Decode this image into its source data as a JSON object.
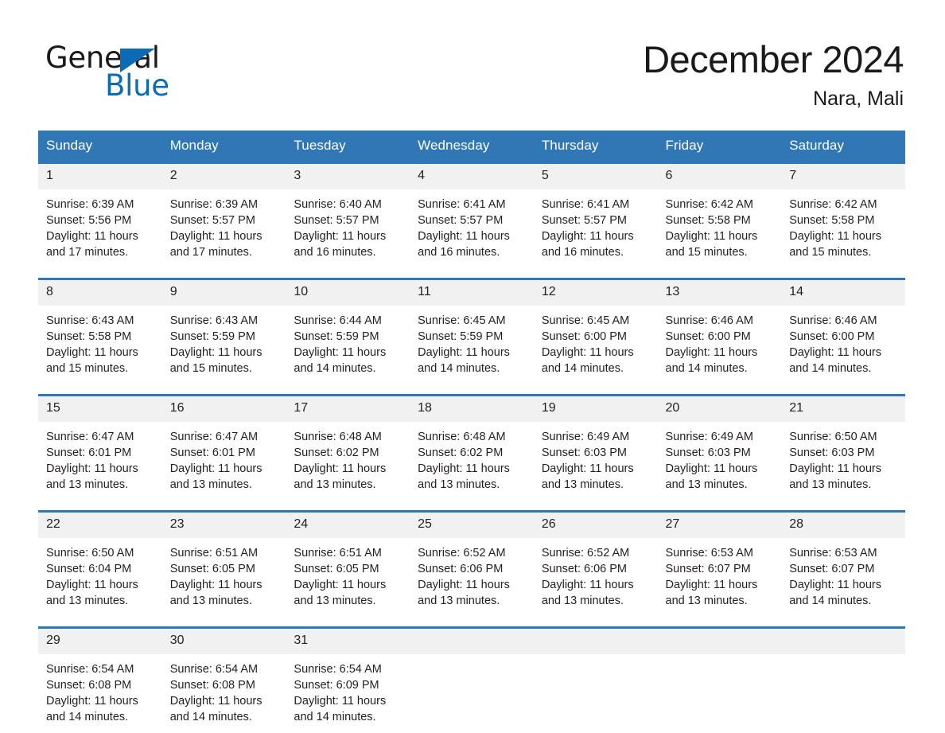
{
  "brand": {
    "name_top": "General",
    "name_bottom": "Blue",
    "triangle_color": "#0b6cb5",
    "logo_icon": "general-blue-logo"
  },
  "header": {
    "month_title": "December 2024",
    "location": "Nara, Mali"
  },
  "theme": {
    "header_blue": "#3077b5",
    "daynum_band": "#f1f1f1",
    "text": "#231f20",
    "page_background": "#ffffff"
  },
  "calendar": {
    "weekday_headers": [
      "Sunday",
      "Monday",
      "Tuesday",
      "Wednesday",
      "Thursday",
      "Friday",
      "Saturday"
    ],
    "labels": {
      "sunrise_prefix": "Sunrise:",
      "sunset_prefix": "Sunset:",
      "daylight_prefix": "Daylight:"
    },
    "weeks": [
      [
        {
          "day": "1",
          "sunrise": "Sunrise: 6:39 AM",
          "sunset": "Sunset: 5:56 PM",
          "daylight": "Daylight: 11 hours and 17 minutes."
        },
        {
          "day": "2",
          "sunrise": "Sunrise: 6:39 AM",
          "sunset": "Sunset: 5:57 PM",
          "daylight": "Daylight: 11 hours and 17 minutes."
        },
        {
          "day": "3",
          "sunrise": "Sunrise: 6:40 AM",
          "sunset": "Sunset: 5:57 PM",
          "daylight": "Daylight: 11 hours and 16 minutes."
        },
        {
          "day": "4",
          "sunrise": "Sunrise: 6:41 AM",
          "sunset": "Sunset: 5:57 PM",
          "daylight": "Daylight: 11 hours and 16 minutes."
        },
        {
          "day": "5",
          "sunrise": "Sunrise: 6:41 AM",
          "sunset": "Sunset: 5:57 PM",
          "daylight": "Daylight: 11 hours and 16 minutes."
        },
        {
          "day": "6",
          "sunrise": "Sunrise: 6:42 AM",
          "sunset": "Sunset: 5:58 PM",
          "daylight": "Daylight: 11 hours and 15 minutes."
        },
        {
          "day": "7",
          "sunrise": "Sunrise: 6:42 AM",
          "sunset": "Sunset: 5:58 PM",
          "daylight": "Daylight: 11 hours and 15 minutes."
        }
      ],
      [
        {
          "day": "8",
          "sunrise": "Sunrise: 6:43 AM",
          "sunset": "Sunset: 5:58 PM",
          "daylight": "Daylight: 11 hours and 15 minutes."
        },
        {
          "day": "9",
          "sunrise": "Sunrise: 6:43 AM",
          "sunset": "Sunset: 5:59 PM",
          "daylight": "Daylight: 11 hours and 15 minutes."
        },
        {
          "day": "10",
          "sunrise": "Sunrise: 6:44 AM",
          "sunset": "Sunset: 5:59 PM",
          "daylight": "Daylight: 11 hours and 14 minutes."
        },
        {
          "day": "11",
          "sunrise": "Sunrise: 6:45 AM",
          "sunset": "Sunset: 5:59 PM",
          "daylight": "Daylight: 11 hours and 14 minutes."
        },
        {
          "day": "12",
          "sunrise": "Sunrise: 6:45 AM",
          "sunset": "Sunset: 6:00 PM",
          "daylight": "Daylight: 11 hours and 14 minutes."
        },
        {
          "day": "13",
          "sunrise": "Sunrise: 6:46 AM",
          "sunset": "Sunset: 6:00 PM",
          "daylight": "Daylight: 11 hours and 14 minutes."
        },
        {
          "day": "14",
          "sunrise": "Sunrise: 6:46 AM",
          "sunset": "Sunset: 6:00 PM",
          "daylight": "Daylight: 11 hours and 14 minutes."
        }
      ],
      [
        {
          "day": "15",
          "sunrise": "Sunrise: 6:47 AM",
          "sunset": "Sunset: 6:01 PM",
          "daylight": "Daylight: 11 hours and 13 minutes."
        },
        {
          "day": "16",
          "sunrise": "Sunrise: 6:47 AM",
          "sunset": "Sunset: 6:01 PM",
          "daylight": "Daylight: 11 hours and 13 minutes."
        },
        {
          "day": "17",
          "sunrise": "Sunrise: 6:48 AM",
          "sunset": "Sunset: 6:02 PM",
          "daylight": "Daylight: 11 hours and 13 minutes."
        },
        {
          "day": "18",
          "sunrise": "Sunrise: 6:48 AM",
          "sunset": "Sunset: 6:02 PM",
          "daylight": "Daylight: 11 hours and 13 minutes."
        },
        {
          "day": "19",
          "sunrise": "Sunrise: 6:49 AM",
          "sunset": "Sunset: 6:03 PM",
          "daylight": "Daylight: 11 hours and 13 minutes."
        },
        {
          "day": "20",
          "sunrise": "Sunrise: 6:49 AM",
          "sunset": "Sunset: 6:03 PM",
          "daylight": "Daylight: 11 hours and 13 minutes."
        },
        {
          "day": "21",
          "sunrise": "Sunrise: 6:50 AM",
          "sunset": "Sunset: 6:03 PM",
          "daylight": "Daylight: 11 hours and 13 minutes."
        }
      ],
      [
        {
          "day": "22",
          "sunrise": "Sunrise: 6:50 AM",
          "sunset": "Sunset: 6:04 PM",
          "daylight": "Daylight: 11 hours and 13 minutes."
        },
        {
          "day": "23",
          "sunrise": "Sunrise: 6:51 AM",
          "sunset": "Sunset: 6:05 PM",
          "daylight": "Daylight: 11 hours and 13 minutes."
        },
        {
          "day": "24",
          "sunrise": "Sunrise: 6:51 AM",
          "sunset": "Sunset: 6:05 PM",
          "daylight": "Daylight: 11 hours and 13 minutes."
        },
        {
          "day": "25",
          "sunrise": "Sunrise: 6:52 AM",
          "sunset": "Sunset: 6:06 PM",
          "daylight": "Daylight: 11 hours and 13 minutes."
        },
        {
          "day": "26",
          "sunrise": "Sunrise: 6:52 AM",
          "sunset": "Sunset: 6:06 PM",
          "daylight": "Daylight: 11 hours and 13 minutes."
        },
        {
          "day": "27",
          "sunrise": "Sunrise: 6:53 AM",
          "sunset": "Sunset: 6:07 PM",
          "daylight": "Daylight: 11 hours and 13 minutes."
        },
        {
          "day": "28",
          "sunrise": "Sunrise: 6:53 AM",
          "sunset": "Sunset: 6:07 PM",
          "daylight": "Daylight: 11 hours and 14 minutes."
        }
      ],
      [
        {
          "day": "29",
          "sunrise": "Sunrise: 6:54 AM",
          "sunset": "Sunset: 6:08 PM",
          "daylight": "Daylight: 11 hours and 14 minutes."
        },
        {
          "day": "30",
          "sunrise": "Sunrise: 6:54 AM",
          "sunset": "Sunset: 6:08 PM",
          "daylight": "Daylight: 11 hours and 14 minutes."
        },
        {
          "day": "31",
          "sunrise": "Sunrise: 6:54 AM",
          "sunset": "Sunset: 6:09 PM",
          "daylight": "Daylight: 11 hours and 14 minutes."
        },
        {
          "day": "",
          "sunrise": "",
          "sunset": "",
          "daylight": ""
        },
        {
          "day": "",
          "sunrise": "",
          "sunset": "",
          "daylight": ""
        },
        {
          "day": "",
          "sunrise": "",
          "sunset": "",
          "daylight": ""
        },
        {
          "day": "",
          "sunrise": "",
          "sunset": "",
          "daylight": ""
        }
      ]
    ]
  }
}
